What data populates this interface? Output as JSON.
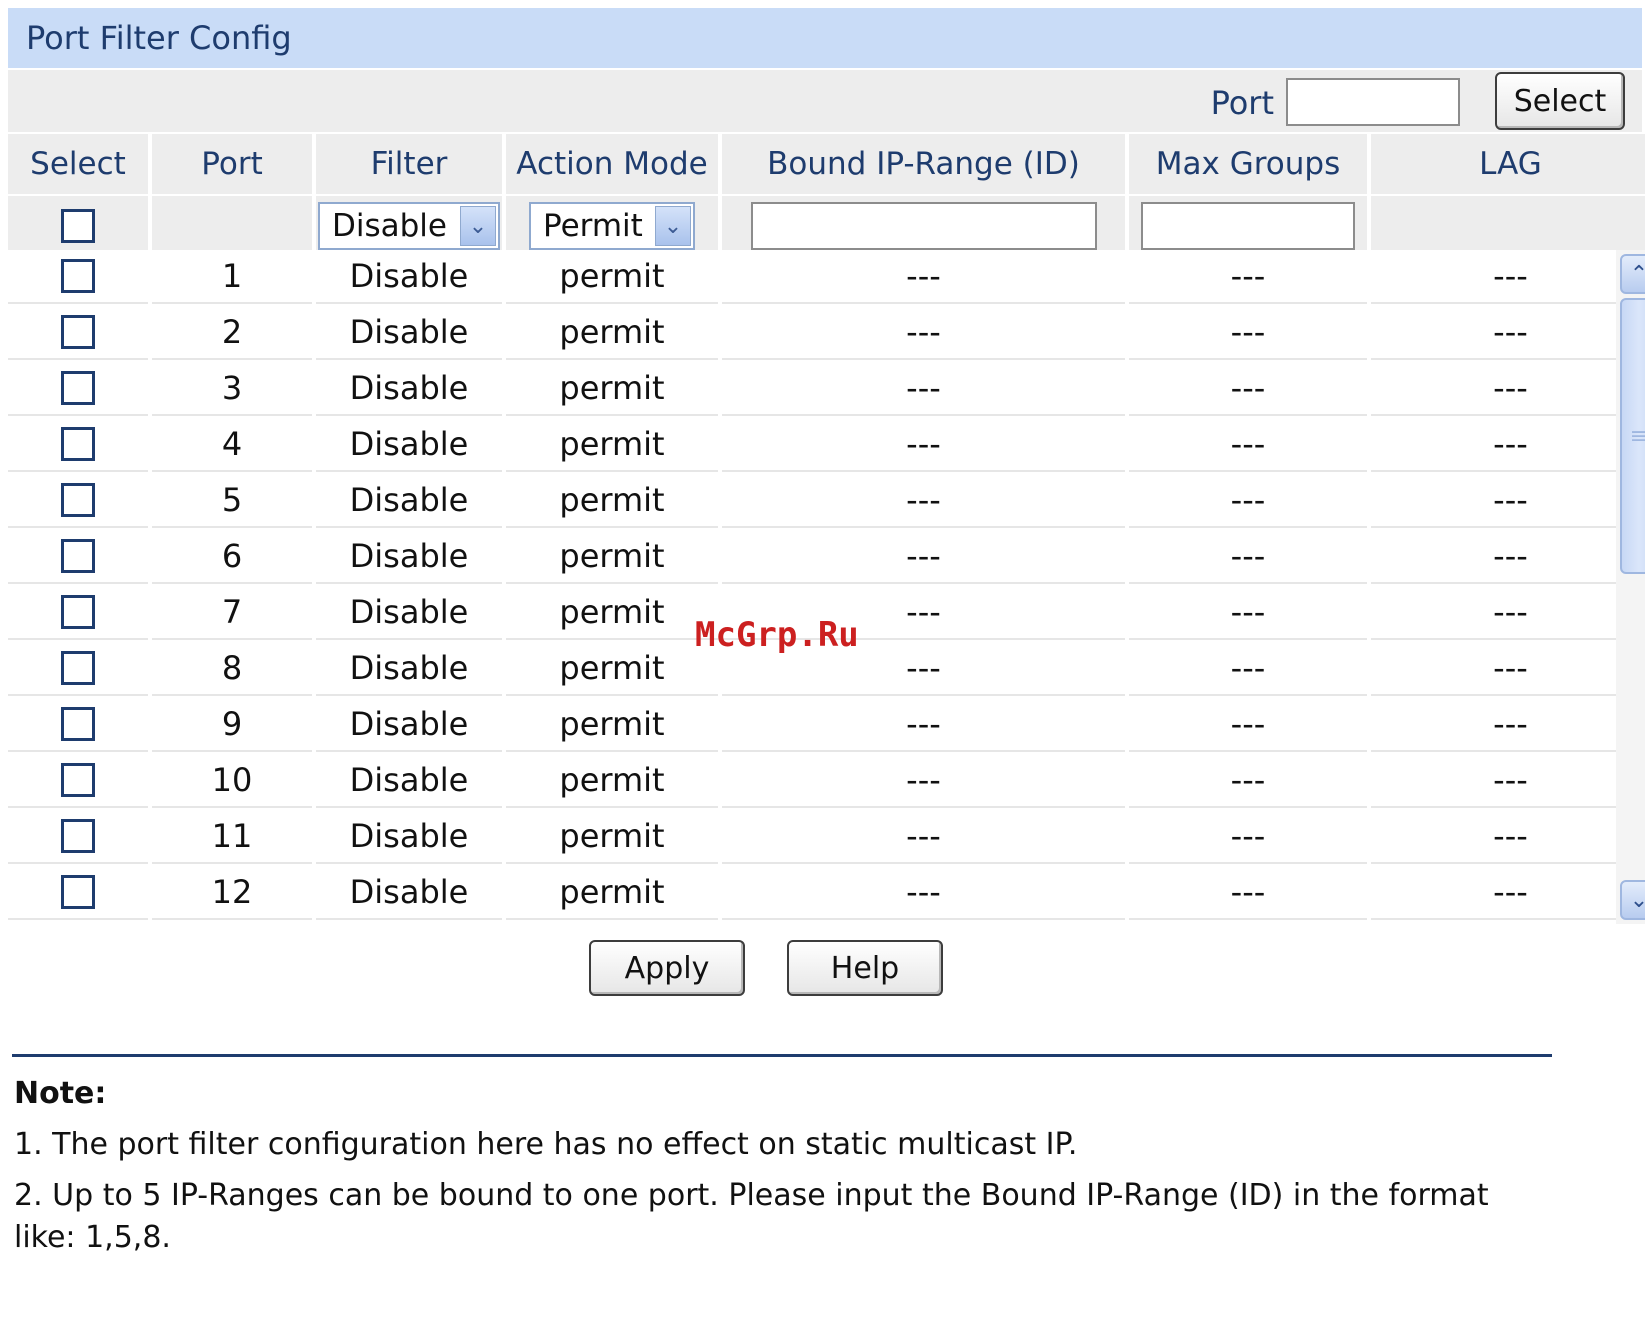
{
  "title": "Port Filter Config",
  "port_select": {
    "label": "Port",
    "value": "",
    "button": "Select"
  },
  "columns": [
    "Select",
    "Port",
    "Filter",
    "Action Mode",
    "Bound IP-Range (ID)",
    "Max Groups",
    "LAG"
  ],
  "filter_row": {
    "filter": "Disable",
    "action_mode": "Permit",
    "bound_ip_range": "",
    "max_groups": ""
  },
  "rows": [
    {
      "port": "1",
      "filter": "Disable",
      "action": "permit",
      "bound": "---",
      "max": "---",
      "lag": "---"
    },
    {
      "port": "2",
      "filter": "Disable",
      "action": "permit",
      "bound": "---",
      "max": "---",
      "lag": "---"
    },
    {
      "port": "3",
      "filter": "Disable",
      "action": "permit",
      "bound": "---",
      "max": "---",
      "lag": "---"
    },
    {
      "port": "4",
      "filter": "Disable",
      "action": "permit",
      "bound": "---",
      "max": "---",
      "lag": "---"
    },
    {
      "port": "5",
      "filter": "Disable",
      "action": "permit",
      "bound": "---",
      "max": "---",
      "lag": "---"
    },
    {
      "port": "6",
      "filter": "Disable",
      "action": "permit",
      "bound": "---",
      "max": "---",
      "lag": "---"
    },
    {
      "port": "7",
      "filter": "Disable",
      "action": "permit",
      "bound": "---",
      "max": "---",
      "lag": "---"
    },
    {
      "port": "8",
      "filter": "Disable",
      "action": "permit",
      "bound": "---",
      "max": "---",
      "lag": "---"
    },
    {
      "port": "9",
      "filter": "Disable",
      "action": "permit",
      "bound": "---",
      "max": "---",
      "lag": "---"
    },
    {
      "port": "10",
      "filter": "Disable",
      "action": "permit",
      "bound": "---",
      "max": "---",
      "lag": "---"
    },
    {
      "port": "11",
      "filter": "Disable",
      "action": "permit",
      "bound": "---",
      "max": "---",
      "lag": "---"
    },
    {
      "port": "12",
      "filter": "Disable",
      "action": "permit",
      "bound": "---",
      "max": "---",
      "lag": "---"
    }
  ],
  "buttons": {
    "apply": "Apply",
    "help": "Help"
  },
  "note": {
    "title": "Note:",
    "lines": [
      "1. The port filter configuration here has no effect on static multicast IP.",
      "2. Up to 5 IP-Ranges can be bound to one port. Please input the Bound IP-Range (ID) in the format like: 1,5,8."
    ]
  },
  "watermark": "McGrp.Ru",
  "icons": {
    "dropdown": "chevron-down-icon",
    "scroll_up": "chevron-up-icon",
    "scroll_down": "chevron-down-icon"
  },
  "colors": {
    "title_bg": "#c9dcf7",
    "header_bg": "#ededed",
    "accent_text": "#1e3c6e",
    "watermark": "#cc2020"
  }
}
